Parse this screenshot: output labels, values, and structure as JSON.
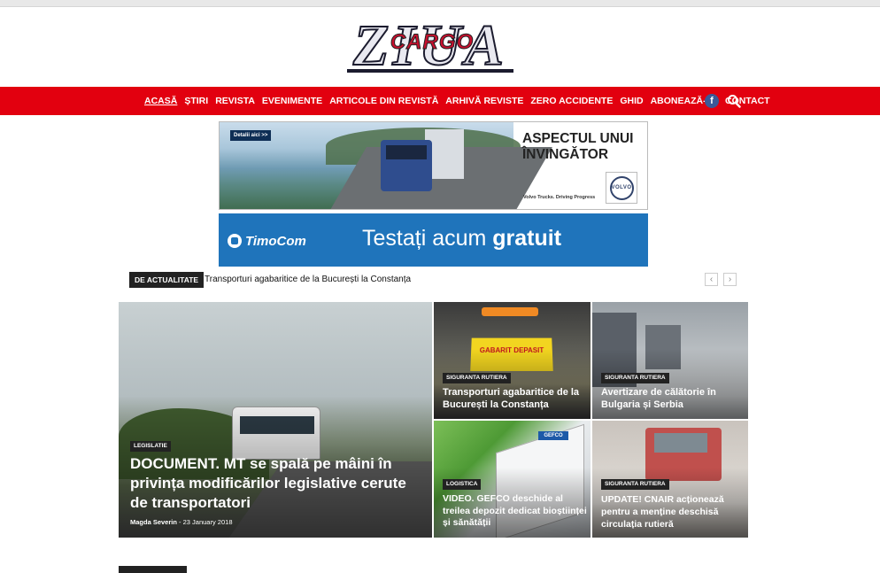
{
  "logo": {
    "brand": "ZIUA",
    "sub": "CARGO"
  },
  "nav": {
    "items": [
      "ACASĂ",
      "ȘTIRI",
      "REVISTA",
      "EVENIMENTE",
      "ARTICOLE DIN REVISTĂ",
      "ARHIVĂ REVISTE",
      "ZERO ACCIDENTE",
      "GHID",
      "ABONEAZĂ-TE",
      "CONTACT"
    ],
    "facebook": "f"
  },
  "ads": {
    "volvo": {
      "button": "Detalii aici >>",
      "headline_1": "ASPECTUL UNUI",
      "headline_2": "ÎNVINGĂTOR",
      "tagline": "Volvo Trucks. Driving Progress",
      "badge": "VOLVO"
    },
    "timocom": {
      "brand": "TimoCom",
      "text_regular": "Testați acum ",
      "text_bold": "gratuit"
    }
  },
  "ticker": {
    "label": "DE ACTUALITATE",
    "headline": "Transporturi agabaritice de la București la Constanța",
    "prev": "‹",
    "next": "›"
  },
  "tiles": {
    "main": {
      "category": "LEGISLATIE",
      "title": "DOCUMENT. MT se spală pe mâini în privința modificărilor legislative cerute de transportatori",
      "author": "Magda Severin",
      "date": "- 23 January 2018"
    },
    "a": {
      "category": "SIGURANTA RUTIERA",
      "title": "Transporturi agabaritice de la București la Constanța",
      "sign": "GABARIT DEPASIT"
    },
    "b": {
      "category": "SIGURANTA RUTIERA",
      "title": "Avertizare de călătorie în Bulgaria și Serbia"
    },
    "c": {
      "category": "LOGISTICA",
      "title": "VIDEO. GEFCO deschide al treilea depozit dedicat bioștiinței și sănătății",
      "brand": "GEFCO"
    },
    "d": {
      "category": "SIGURANTA RUTIERA",
      "title": "UPDATE! CNAIR acționează pentru a menține deschisă circulația rutieră"
    }
  }
}
